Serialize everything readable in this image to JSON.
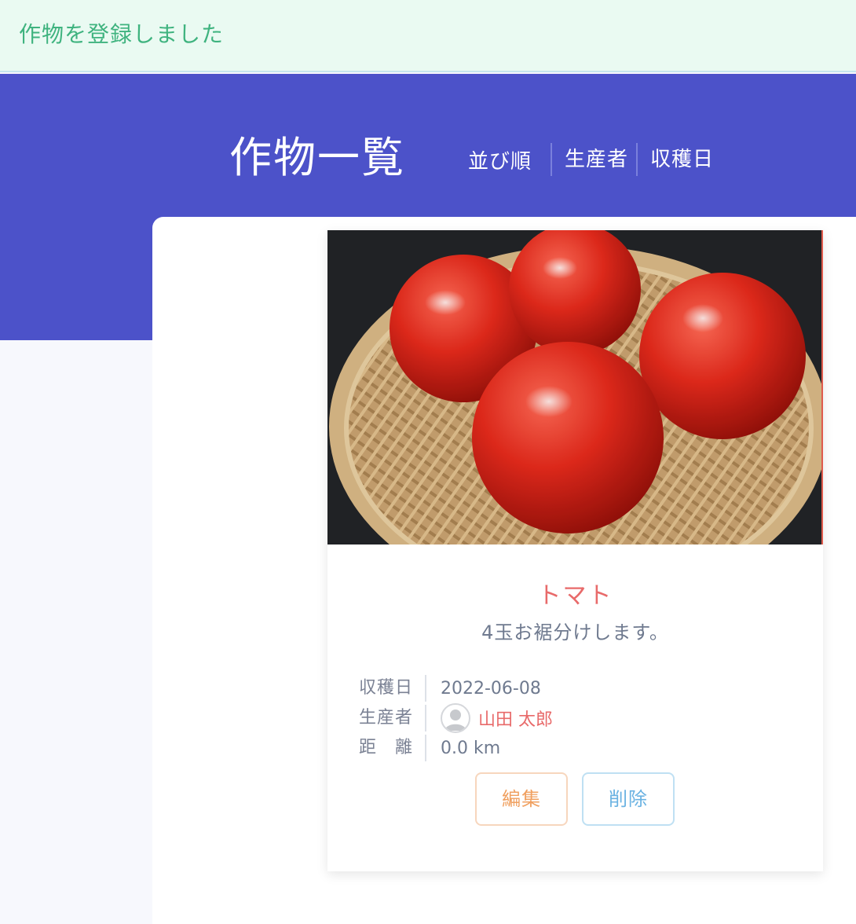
{
  "flash": {
    "message": "作物を登録しました"
  },
  "header": {
    "title": "作物一覧",
    "sort_label": "並び順",
    "sort_options": [
      "生産者",
      "収穫日"
    ]
  },
  "crop": {
    "name": "トマト",
    "description": "4玉お裾分けします。",
    "details": [
      {
        "key": "収穫日",
        "value": "2022-06-08"
      },
      {
        "key": "生産者",
        "value": "山田 太郎"
      },
      {
        "key": "距　離",
        "value": "0.0 km"
      }
    ],
    "photo_subject": "tomatoes-in-bamboo-basket",
    "buttons": {
      "edit": "編集",
      "delete": "削除"
    }
  },
  "colors": {
    "hero": "#4c52c9",
    "flash_bg": "#eafaf2",
    "flash_text": "#3fb37f",
    "accent": "#e86a6a",
    "edit": "#f0a060",
    "delete": "#6ab2e2"
  }
}
